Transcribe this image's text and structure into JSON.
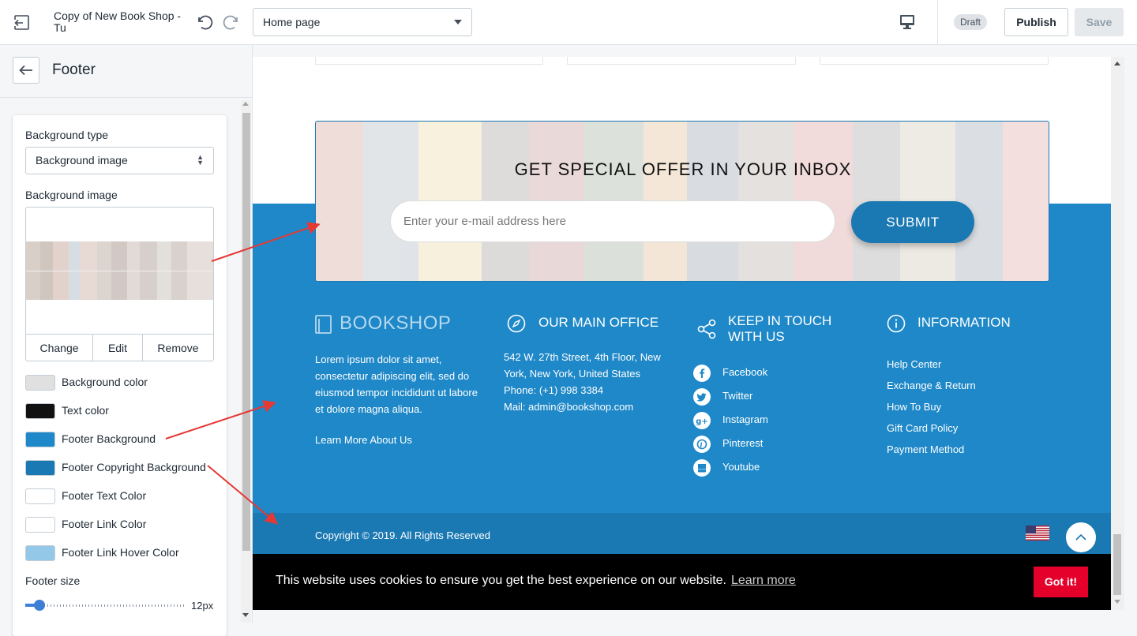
{
  "topbar": {
    "store_title": "Copy of New Book Shop - Tu",
    "page_select": "Home page",
    "draft_badge": "Draft",
    "publish_label": "Publish",
    "save_label": "Save"
  },
  "sidebar": {
    "title": "Footer",
    "background_type_label": "Background type",
    "background_type_value": "Background image",
    "background_image_label": "Background image",
    "image_actions": [
      "Change",
      "Edit",
      "Remove"
    ],
    "colors": [
      {
        "label": "Background color",
        "value": "#e0e0e0"
      },
      {
        "label": "Text color",
        "value": "#111111"
      },
      {
        "label": "Footer Background",
        "value": "#1e88c8"
      },
      {
        "label": "Footer Copyright Background",
        "value": "#1a78b3"
      },
      {
        "label": "Footer Text Color",
        "value": "#ffffff"
      },
      {
        "label": "Footer Link Color",
        "value": "#ffffff"
      },
      {
        "label": "Footer Link Hover Color",
        "value": "#93c8e8"
      }
    ],
    "footer_size_label": "Footer size",
    "footer_size_value": "12px",
    "footer_size_fraction": 0.09
  },
  "preview": {
    "newsletter": {
      "title": "GET SPECIAL OFFER IN YOUR INBOX",
      "input_placeholder": "Enter your e-mail address here",
      "submit_label": "SUBMIT"
    },
    "about": {
      "logo": "BOOKSHOP",
      "text": "Lorem ipsum dolor sit amet, consectetur adipiscing elit, sed do eiusmod tempor incididunt ut labore et dolore magna aliqua.",
      "link": "Learn More About Us"
    },
    "office": {
      "heading": "OUR MAIN OFFICE",
      "address": "542 W. 27th Street, 4th Floor, New York, New York, United States",
      "phone": "Phone: (+1) 998 3384",
      "mail": "Mail: admin@bookshop.com"
    },
    "touch": {
      "heading": "KEEP IN TOUCH WITH US",
      "items": [
        "Facebook",
        "Twitter",
        "Instagram",
        "Pinterest",
        "Youtube"
      ]
    },
    "information": {
      "heading": "INFORMATION",
      "links": [
        "Help Center",
        "Exchange & Return",
        "How To Buy",
        "Gift Card Policy",
        "Payment Method"
      ]
    },
    "copyright": "Copyright © 2019. All Rights Reserved",
    "cookie": {
      "text": "This website uses cookies to ensure you get the best experience on our website.",
      "learn_more": "Learn more",
      "button": "Got it!"
    }
  },
  "colors": {
    "footer_bg": "#1e88c8",
    "copyright_bg": "#1a78b3",
    "cookie_btn": "#e5002b",
    "annotation_arrow": "#e53935"
  }
}
